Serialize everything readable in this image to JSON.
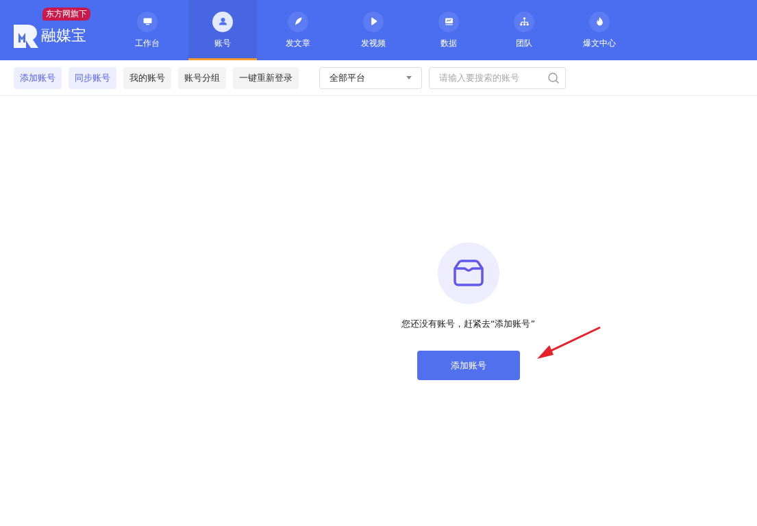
{
  "brand": {
    "name": "融媒宝",
    "badge": "东方网旗下"
  },
  "nav": [
    {
      "label": "工作台",
      "selected": false
    },
    {
      "label": "账号",
      "selected": true
    },
    {
      "label": "发文章",
      "selected": false
    },
    {
      "label": "发视频",
      "selected": false
    },
    {
      "label": "数据",
      "selected": false
    },
    {
      "label": "团队",
      "selected": false
    },
    {
      "label": "爆文中心",
      "selected": false
    }
  ],
  "toolbar": {
    "buttons": [
      {
        "label": "添加账号",
        "kind": "accent"
      },
      {
        "label": "同步账号",
        "kind": "accent"
      },
      {
        "label": "我的账号",
        "kind": "plain"
      },
      {
        "label": "账号分组",
        "kind": "plain"
      },
      {
        "label": "一键重新登录",
        "kind": "plain"
      }
    ],
    "platform_select": {
      "value": "全部平台"
    },
    "search": {
      "placeholder": "请输入要搜索的账号"
    }
  },
  "empty_state": {
    "message": "您还没有账号，赶紧去“添加账号”",
    "button": "添加账号"
  }
}
